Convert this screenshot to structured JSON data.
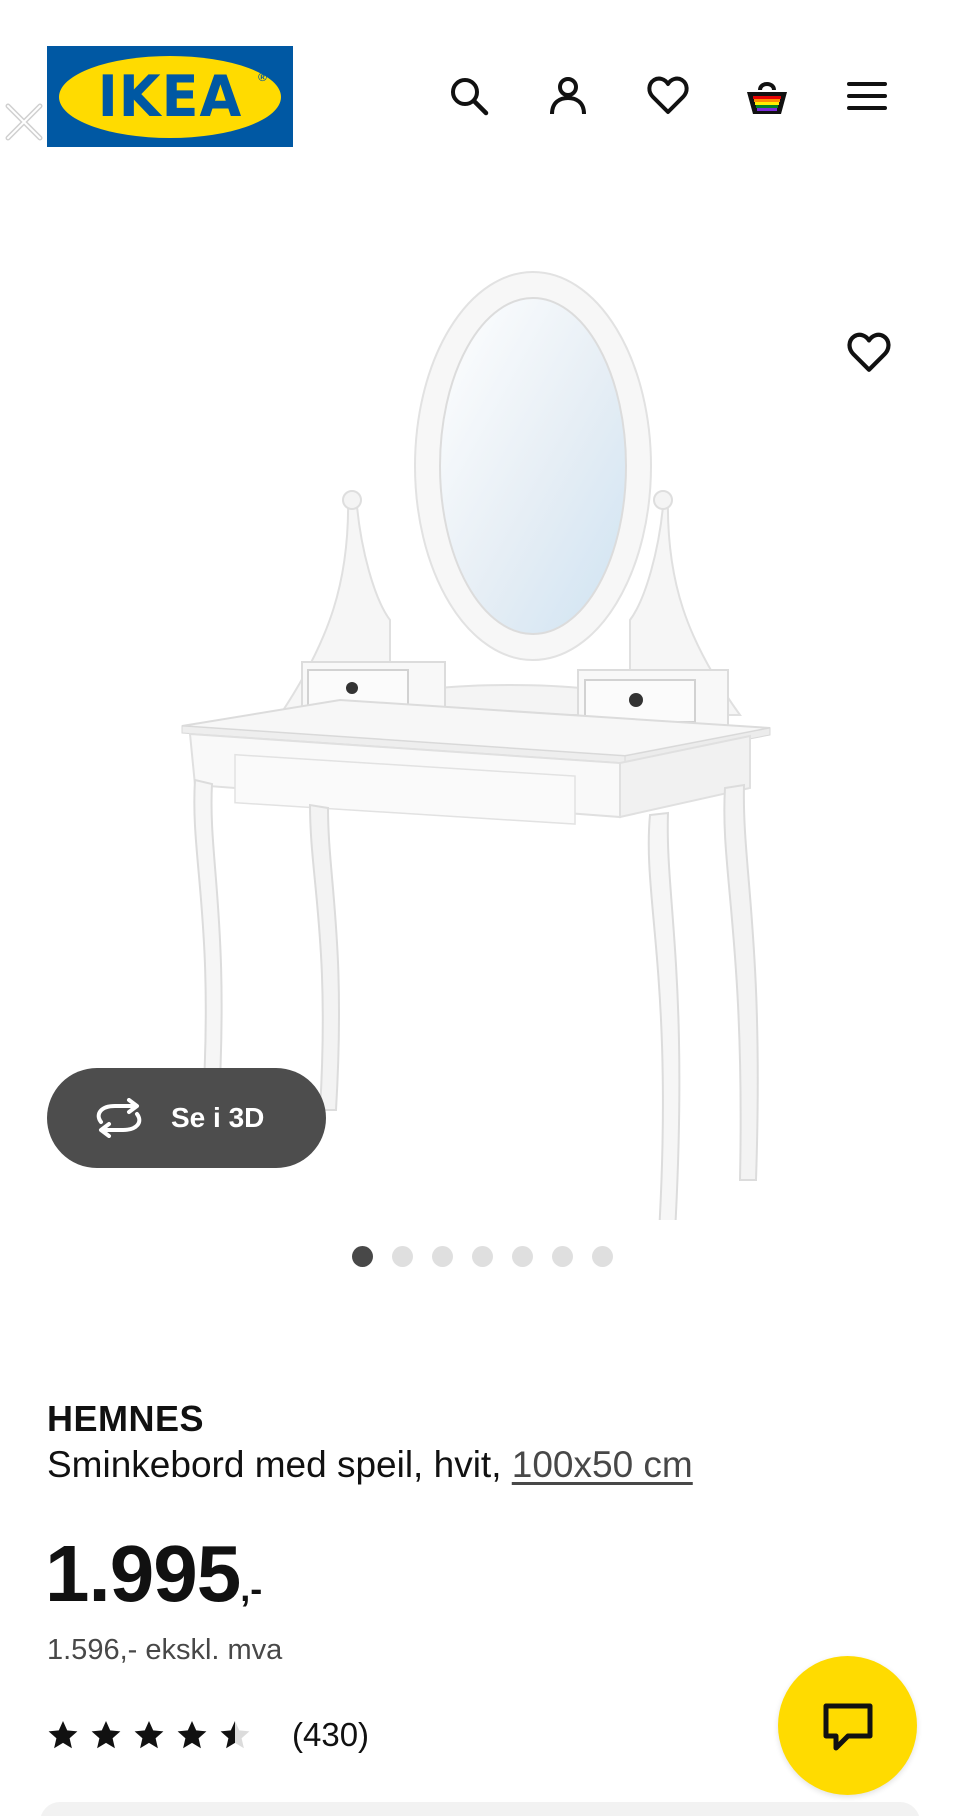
{
  "header": {
    "logo_text": "IKEA",
    "logo_mark": "®",
    "icons": [
      "close-icon",
      "search-icon",
      "profile-icon",
      "heart-icon",
      "shopping-bag-icon",
      "hamburger-menu-icon"
    ],
    "colors": {
      "brand_blue": "#0058a3",
      "brand_yellow": "#ffdb00"
    }
  },
  "gallery": {
    "image_icon": "vanity-table-with-mirror",
    "see_3d_label": "Se i 3D",
    "see_3d_icon": "rotate-3d-icon",
    "favourite_icon": "heart-icon",
    "image_count": 7,
    "active_image": 1
  },
  "product": {
    "brand": "HEMNES",
    "description": "Sminkebord med speil, hvit, ",
    "size_link": "100x50 cm",
    "price_main": "1.995",
    "price_suffix": ",-",
    "price_ex_vat": "1.596,- ekskl. mva",
    "rating_stars": 4.5,
    "rating_count": "(430)"
  },
  "chat": {
    "icon": "chat-bubble-icon"
  }
}
